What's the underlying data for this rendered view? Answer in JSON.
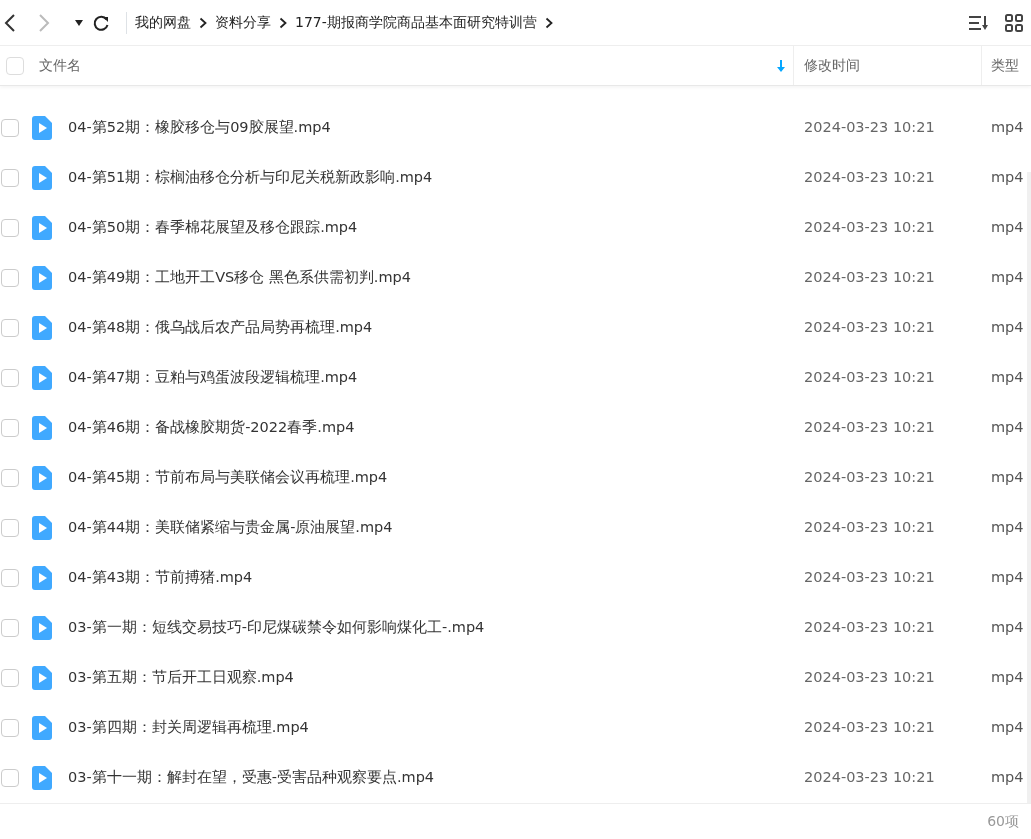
{
  "toolbar": {
    "breadcrumb": [
      {
        "label": "我的网盘"
      },
      {
        "label": "资料分享"
      },
      {
        "label": "177-期报商学院商品基本面研究特训营"
      }
    ]
  },
  "table": {
    "select_all": {
      "checked": false
    },
    "columns": [
      {
        "label": "文件名",
        "sorted": true
      },
      {
        "label": "修改时间",
        "sorted": false
      },
      {
        "label": "类型",
        "sorted": false
      }
    ],
    "rows": [
      {
        "name": "04-第52期：橡胶移仓与09胶展望.mp4",
        "modified": "2024-03-23 10:21",
        "type": "mp4",
        "checked": false
      },
      {
        "name": "04-第51期：棕榈油移仓分析与印尼关税新政影响.mp4",
        "modified": "2024-03-23 10:21",
        "type": "mp4",
        "checked": false
      },
      {
        "name": "04-第50期：春季棉花展望及移仓跟踪.mp4",
        "modified": "2024-03-23 10:21",
        "type": "mp4",
        "checked": false
      },
      {
        "name": "04-第49期：工地开工VS移仓 黑色系供需初判.mp4",
        "modified": "2024-03-23 10:21",
        "type": "mp4",
        "checked": false
      },
      {
        "name": "04-第48期：俄乌战后农产品局势再梳理.mp4",
        "modified": "2024-03-23 10:21",
        "type": "mp4",
        "checked": false
      },
      {
        "name": "04-第47期：豆粕与鸡蛋波段逻辑梳理.mp4",
        "modified": "2024-03-23 10:21",
        "type": "mp4",
        "checked": false
      },
      {
        "name": "04-第46期：备战橡胶期货-2022春季.mp4",
        "modified": "2024-03-23 10:21",
        "type": "mp4",
        "checked": false
      },
      {
        "name": "04-第45期：节前布局与美联储会议再梳理.mp4",
        "modified": "2024-03-23 10:21",
        "type": "mp4",
        "checked": false
      },
      {
        "name": "04-第44期：美联储紧缩与贵金属-原油展望.mp4",
        "modified": "2024-03-23 10:21",
        "type": "mp4",
        "checked": false
      },
      {
        "name": "04-第43期：节前搏猪.mp4",
        "modified": "2024-03-23 10:21",
        "type": "mp4",
        "checked": false
      },
      {
        "name": "03-第一期：短线交易技巧-印尼煤碳禁令如何影响煤化工-.mp4",
        "modified": "2024-03-23 10:21",
        "type": "mp4",
        "checked": false
      },
      {
        "name": "03-第五期：节后开工日观察.mp4",
        "modified": "2024-03-23 10:21",
        "type": "mp4",
        "checked": false
      },
      {
        "name": "03-第四期：封关周逻辑再梳理.mp4",
        "modified": "2024-03-23 10:21",
        "type": "mp4",
        "checked": false
      },
      {
        "name": "03-第十一期：解封在望，受惠-受害品种观察要点.mp4",
        "modified": "2024-03-23 10:21",
        "type": "mp4",
        "checked": false
      }
    ]
  },
  "status_bar": {
    "count": "60项"
  }
}
